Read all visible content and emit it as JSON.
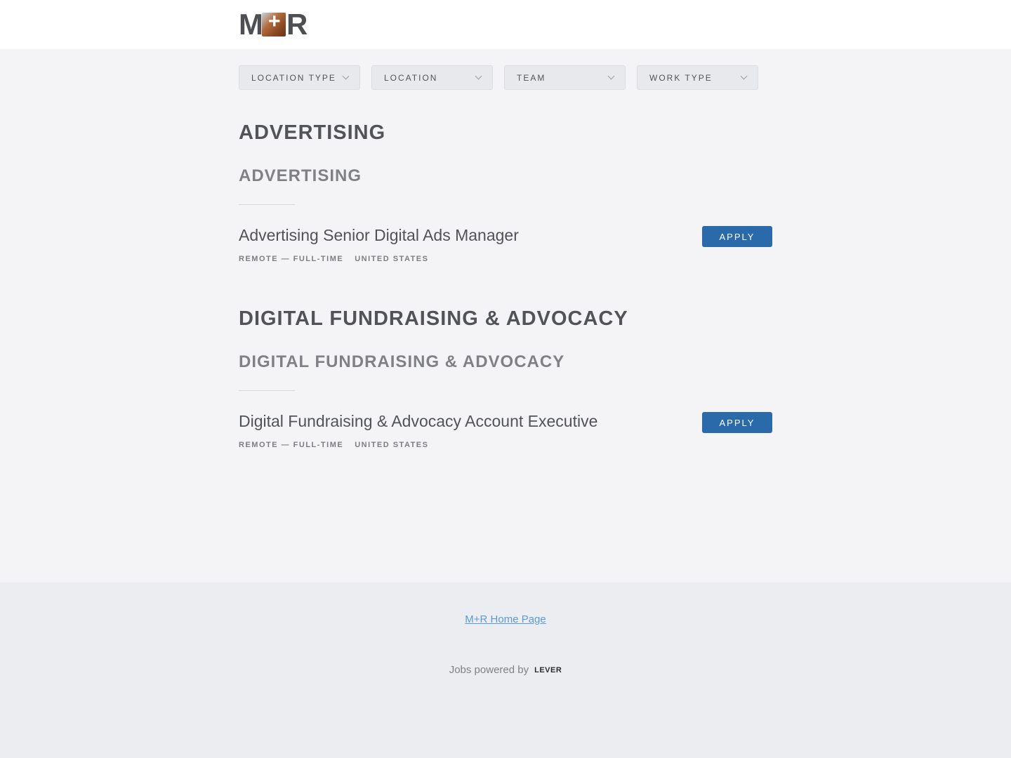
{
  "logo": {
    "left": "M",
    "right": "R",
    "alt": "M+R"
  },
  "filters": [
    {
      "label": "LOCATION TYPE"
    },
    {
      "label": "LOCATION"
    },
    {
      "label": "TEAM"
    },
    {
      "label": "WORK TYPE"
    }
  ],
  "groups": [
    {
      "team": "ADVERTISING",
      "department": "ADVERTISING",
      "postings": [
        {
          "title": "Advertising Senior Digital Ads Manager",
          "commitment": "REMOTE — FULL-TIME",
          "location": "UNITED STATES",
          "apply_label": "APPLY"
        }
      ]
    },
    {
      "team": "DIGITAL FUNDRAISING & ADVOCACY",
      "department": "DIGITAL FUNDRAISING & ADVOCACY",
      "postings": [
        {
          "title": "Digital Fundraising & Advocacy Account Executive",
          "commitment": "REMOTE — FULL-TIME",
          "location": "UNITED STATES",
          "apply_label": "APPLY"
        }
      ]
    }
  ],
  "footer": {
    "home_link": "M+R Home Page",
    "powered_by": "Jobs powered by",
    "lever": "LEVER"
  }
}
